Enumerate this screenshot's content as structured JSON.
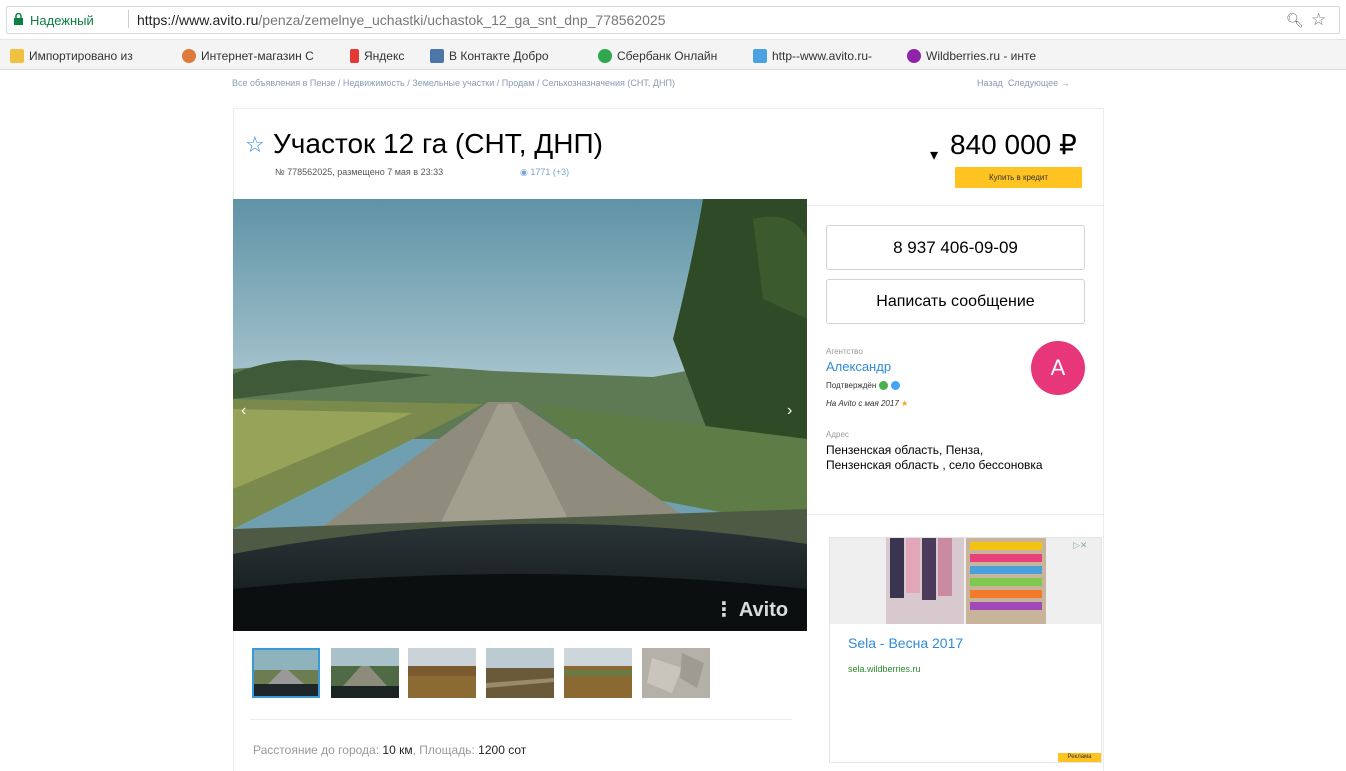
{
  "browser": {
    "secure_label": "Надежный",
    "url_domain": "https://www.avito.ru",
    "url_path": "/penza/zemelnye_uchastki/uchastok_12_ga_snt_dnp_778562025",
    "bookmarks": [
      {
        "label": "Импортировано из ",
        "color": "#f0c040"
      },
      {
        "label": "Интернет-магазин С",
        "color": "#e07a3a"
      },
      {
        "label": "Яндекс",
        "color": "#e53935"
      },
      {
        "label": "В Контакте  Добро",
        "color": "#4a76a8"
      },
      {
        "label": "Сбербанк Онлайн",
        "color": "#2fa84f"
      },
      {
        "label": "http--www.avito.ru-",
        "color": "#4aa3df"
      },
      {
        "label": "Wildberries.ru - инте",
        "color": "#8e24aa"
      }
    ]
  },
  "breadcrumbs": "Все объявления в Пензе / Недвижимость / Земельные участки / Продам / Сельхозназначения (СНТ, ДНП)",
  "nav": {
    "back": "Назад",
    "next": "Следующее →"
  },
  "listing": {
    "title": "Участок 12 га (СНТ, ДНП)",
    "meta": "№ 778562025, размещено 7 мая в 23:33",
    "views": "1771 (+3)",
    "price": "840 000 ₽",
    "credit_button": "Купить в кредит",
    "watermark": "Avito",
    "thumbnail_count": 6,
    "params": {
      "distance_label": "Расстояние до города:",
      "distance_value": "10 км",
      "area_label": "Площадь:",
      "area_value": "1200 сот"
    }
  },
  "contact": {
    "phone": "8 937 406-09-09",
    "message_button": "Написать сообщение",
    "seller_type_label": "Агентство",
    "seller_name": "Александр",
    "confirmed_label": "Подтверждён",
    "since": "На Avito с мая 2017",
    "avatar_letter": "A",
    "avatar_color": "#e8367a",
    "address_label": "Адрес",
    "address": "Пензенская область, Пенза, Пензенская область , село бессоновка"
  },
  "ad": {
    "title": "Sela - Весна 2017",
    "url": "sela.wildberries.ru",
    "label": "Реклама"
  },
  "colors": {
    "accent": "#2e8ad8",
    "credit": "#ffc421"
  }
}
